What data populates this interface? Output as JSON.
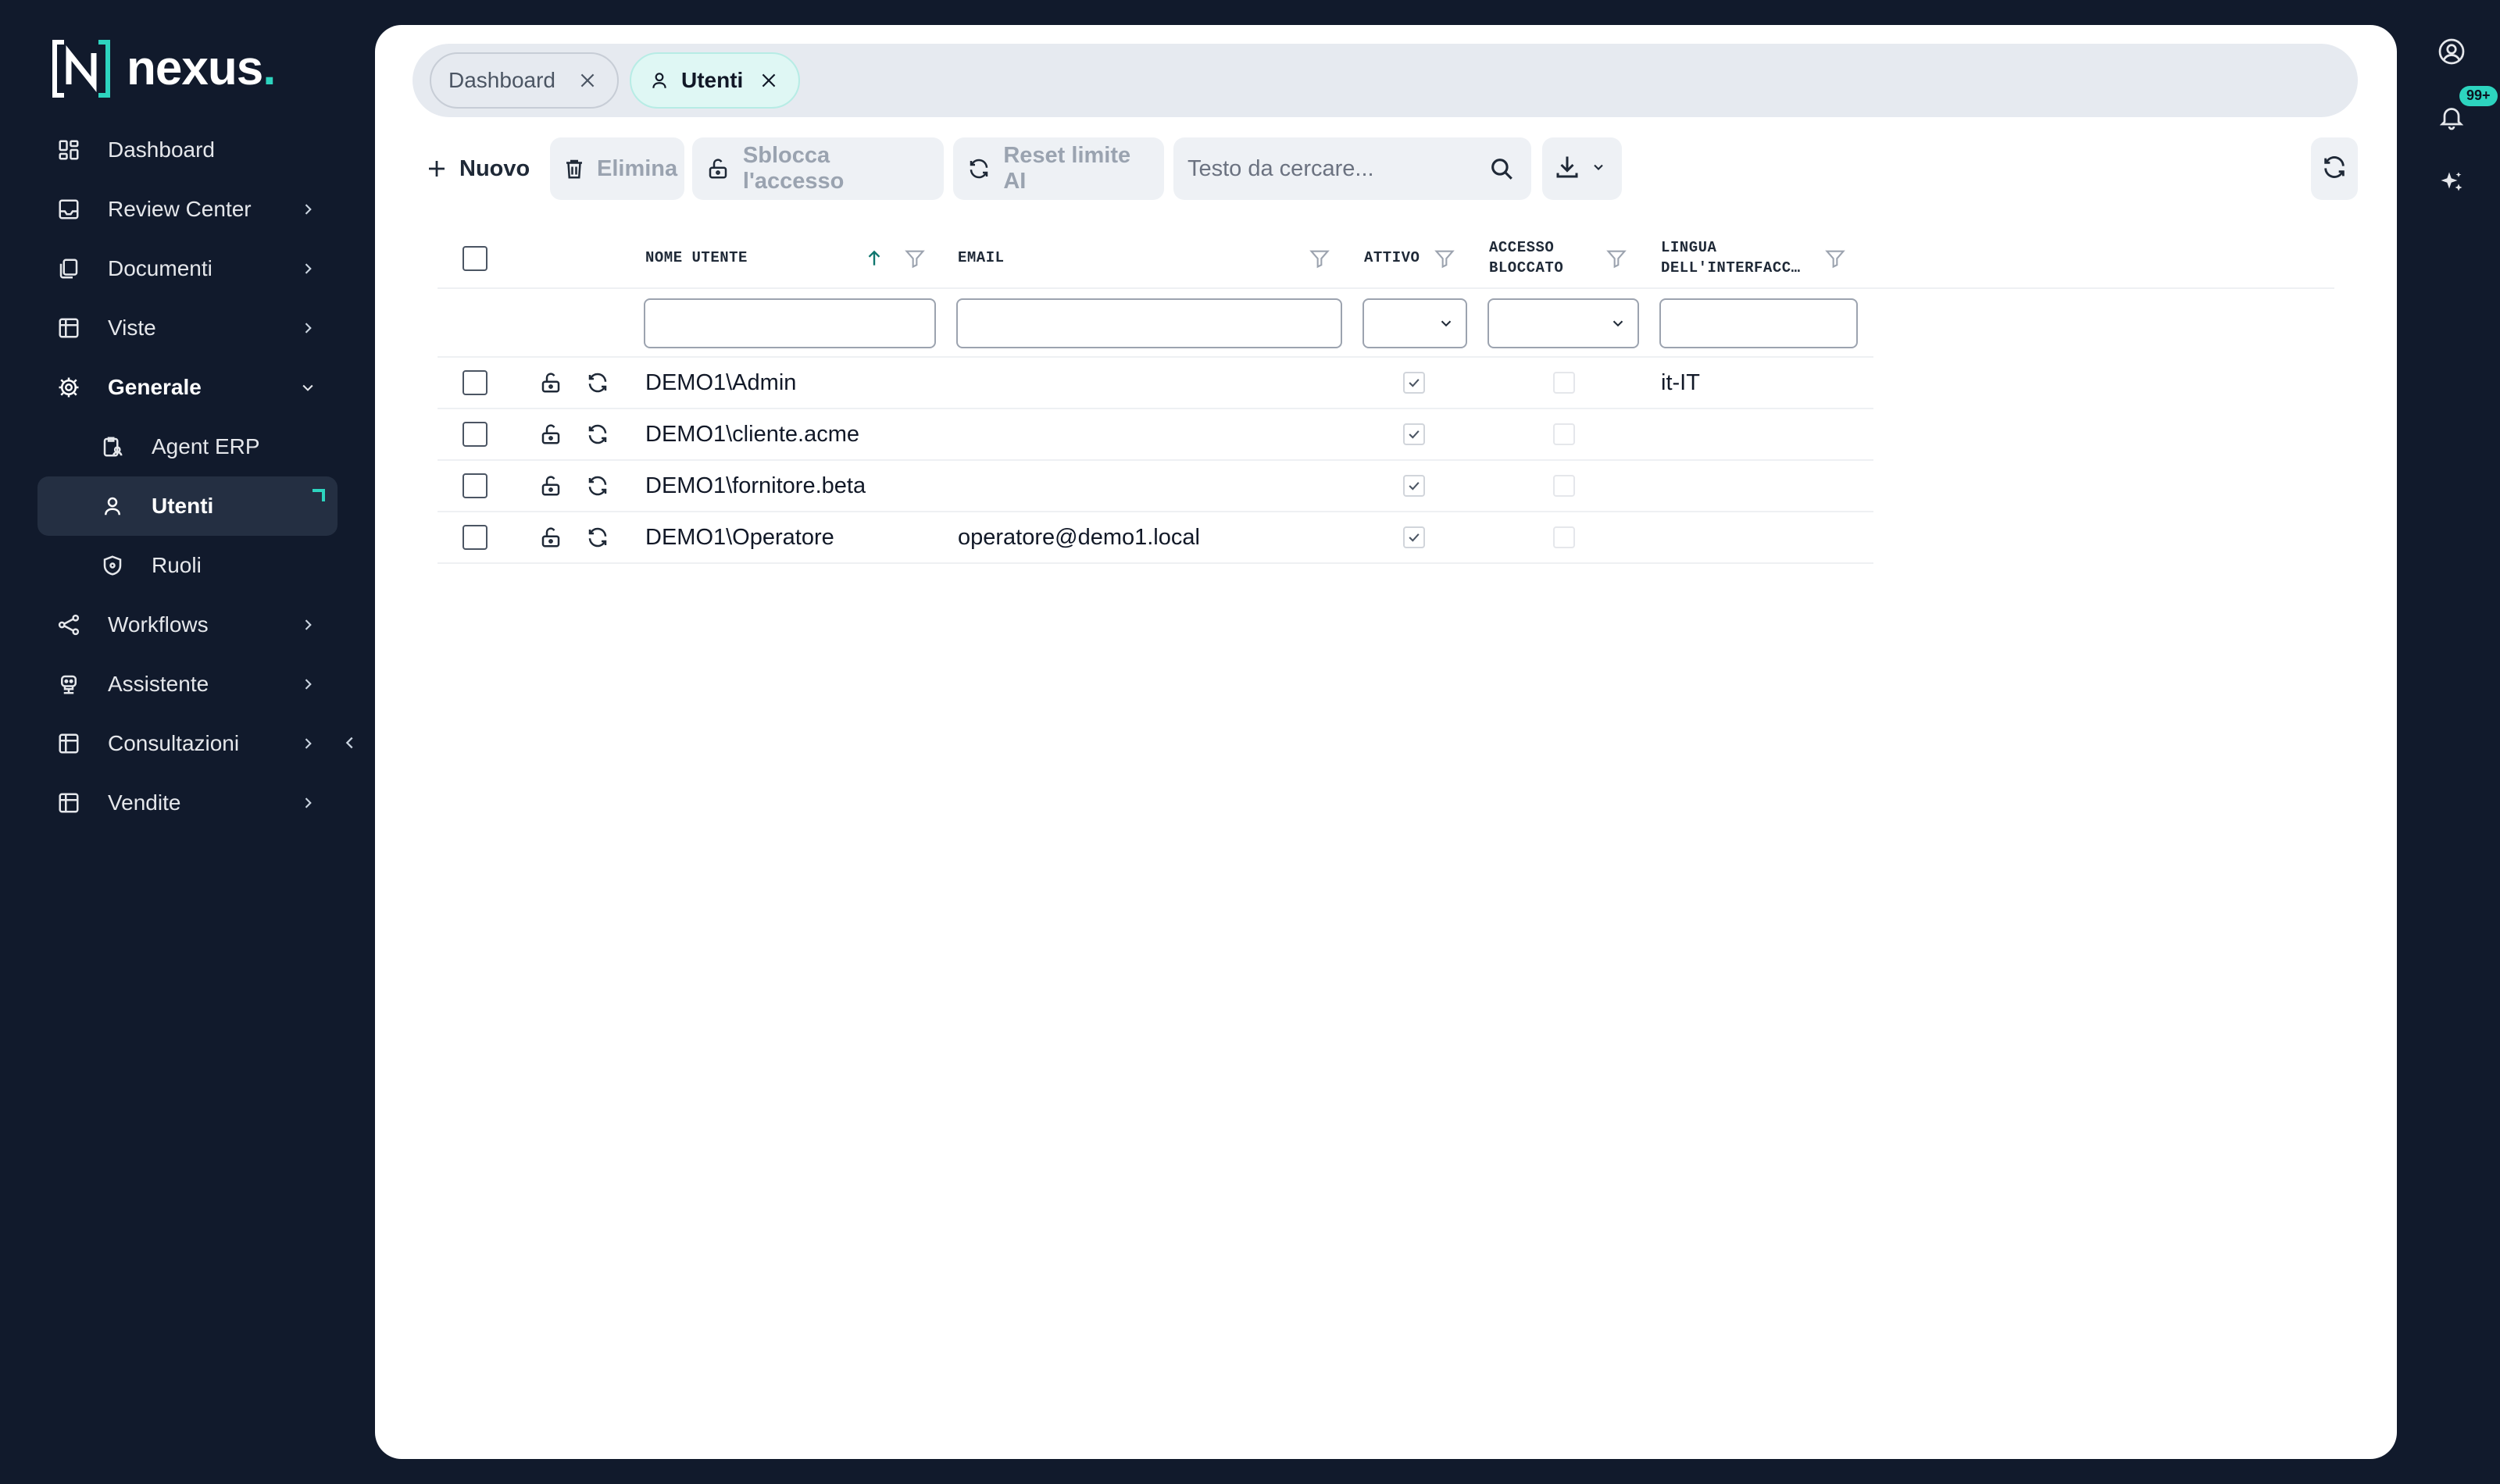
{
  "brand": {
    "name": "nexus",
    "dot": ".",
    "logo_letter": "N"
  },
  "sidebar": {
    "items": [
      {
        "label": "Dashboard",
        "icon": "dashboard-grid-icon"
      },
      {
        "label": "Review Center",
        "icon": "inbox-icon"
      },
      {
        "label": "Documenti",
        "icon": "documents-icon"
      },
      {
        "label": "Viste",
        "icon": "table-icon"
      },
      {
        "label": "Generale",
        "icon": "gear-icon"
      },
      {
        "label": "Agent ERP",
        "icon": "clipboard-user-icon"
      },
      {
        "label": "Utenti",
        "icon": "user-icon"
      },
      {
        "label": "Ruoli",
        "icon": "shield-icon"
      },
      {
        "label": "Workflows",
        "icon": "share-nodes-icon"
      },
      {
        "label": "Assistente",
        "icon": "robot-icon"
      },
      {
        "label": "Consultazioni",
        "icon": "table-icon"
      },
      {
        "label": "Vendite",
        "icon": "table-icon"
      }
    ]
  },
  "tabs": [
    {
      "label": "Dashboard",
      "active": false
    },
    {
      "label": "Utenti",
      "active": true
    }
  ],
  "toolbar": {
    "new_label": "Nuovo",
    "delete_label": "Elimina",
    "unlock_label": "Sblocca l'accesso",
    "reset_label": "Reset limite AI",
    "search_placeholder": "Testo da cercare..."
  },
  "notifications": {
    "badge": "99+"
  },
  "grid": {
    "columns": {
      "username": "NOME UTENTE",
      "email": "EMAIL",
      "active": "ATTIVO",
      "blocked_1": "ACCESSO",
      "blocked_2": "BLOCCATO",
      "lang_1": "LINGUA",
      "lang_2": "DELL'INTERFACC…"
    },
    "rows": [
      {
        "username": "DEMO1\\Admin",
        "email": "",
        "active": true,
        "blocked": false,
        "lang": "it-IT"
      },
      {
        "username": "DEMO1\\cliente.acme",
        "email": "",
        "active": true,
        "blocked": false,
        "lang": ""
      },
      {
        "username": "DEMO1\\fornitore.beta",
        "email": "",
        "active": true,
        "blocked": false,
        "lang": ""
      },
      {
        "username": "DEMO1\\Operatore",
        "email": "operatore@demo1.local",
        "active": true,
        "blocked": false,
        "lang": ""
      }
    ]
  },
  "colors": {
    "accent": "#2dd4bf",
    "sidebar_bg": "#111a2c",
    "active_item_bg": "#242f42"
  }
}
